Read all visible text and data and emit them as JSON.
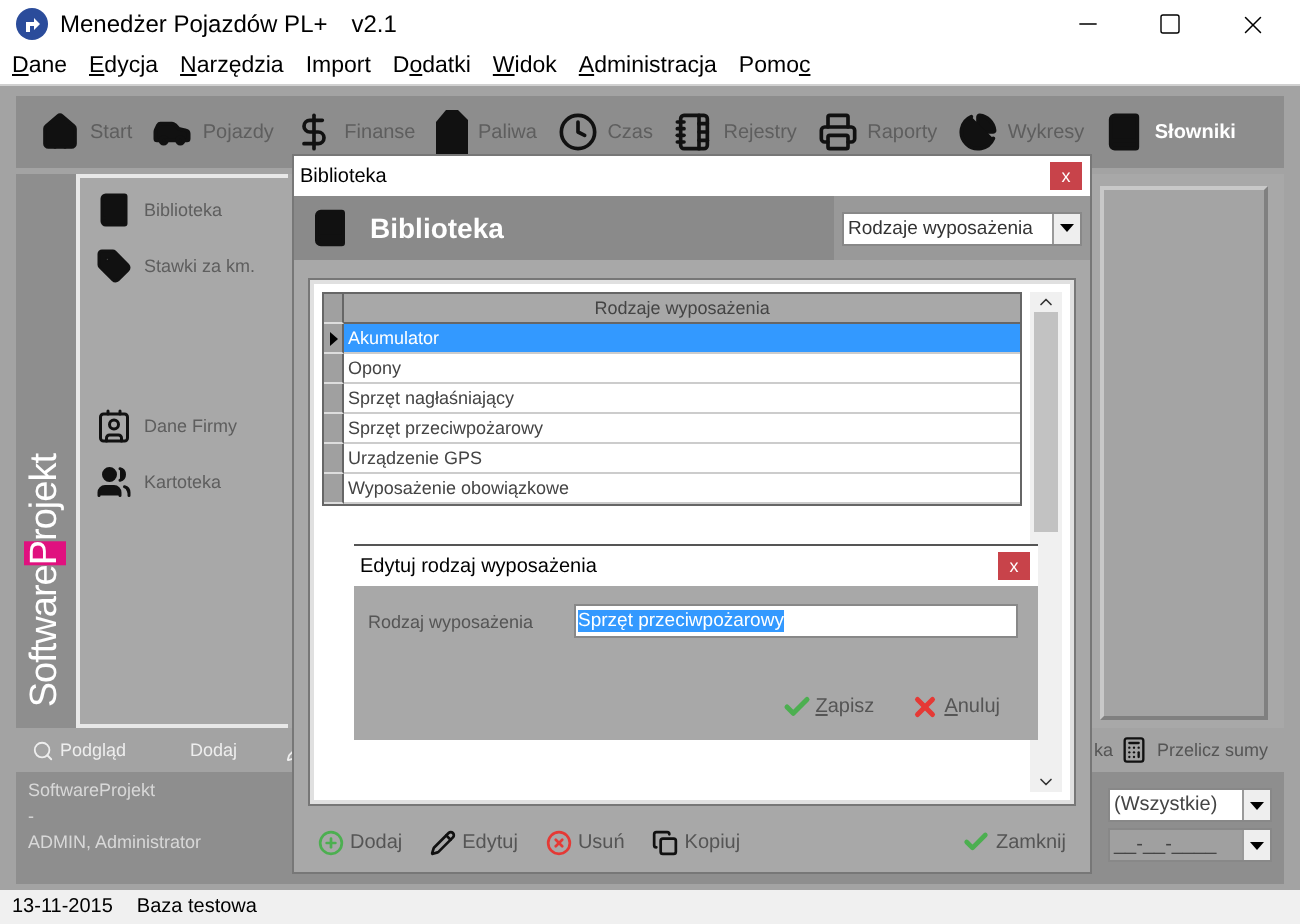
{
  "window": {
    "title": "Menedżer Pojazdów PL+",
    "version": "v2.1"
  },
  "menu": [
    {
      "key": "D",
      "after": "ane"
    },
    {
      "key": "E",
      "after": "dycja"
    },
    {
      "key": "N",
      "after": "arzędzia"
    },
    {
      "before": "Import"
    },
    {
      "before": "D",
      "key": "o",
      "after": "datki"
    },
    {
      "key": "W",
      "after": "idok"
    },
    {
      "key": "A",
      "after": "dministracja"
    },
    {
      "before": "Pomo",
      "key": "c"
    }
  ],
  "toolbar": [
    {
      "label": "Start",
      "selected": false
    },
    {
      "label": "Pojazdy",
      "selected": false
    },
    {
      "label": "Finanse",
      "selected": false
    },
    {
      "label": "Paliwa",
      "selected": false
    },
    {
      "label": "Czas",
      "selected": false
    },
    {
      "label": "Rejestry",
      "selected": false
    },
    {
      "label": "Raporty",
      "selected": false
    },
    {
      "label": "Wykresy",
      "selected": false
    },
    {
      "label": "Słowniki",
      "selected": true
    }
  ],
  "brand": {
    "before": "Software",
    "highlight": "P",
    "after": "rojekt"
  },
  "sidebar": {
    "groups": [
      [
        {
          "label": "Biblioteka"
        },
        {
          "label": "Stawki za km."
        }
      ],
      [
        {
          "label": "Dane Firmy"
        },
        {
          "label": "Kartoteka"
        }
      ]
    ]
  },
  "actions": {
    "left": [
      "Podgląd",
      "Dodaj"
    ],
    "right_cut": "ka",
    "right": "Przelicz sumy"
  },
  "info": [
    "SoftwareProjekt",
    "-",
    "ADMIN, Administrator"
  ],
  "filters": [
    {
      "value": "(Wszystkie)",
      "disabled": false
    },
    {
      "value": "__-__-____",
      "disabled": true
    }
  ],
  "status_bar": [
    "13-11-2015",
    "Baza testowa"
  ],
  "dialog": {
    "title": "Biblioteka",
    "header": "Biblioteka",
    "dropdown": "Rodzaje wyposażenia",
    "grid": {
      "column": "Rodzaje wyposażenia",
      "rows": [
        {
          "label": "Akumulator",
          "selected": true
        },
        {
          "label": "Opony",
          "selected": false
        },
        {
          "label": "Sprzęt nagłaśniający",
          "selected": false
        },
        {
          "label": "Sprzęt przeciwpożarowy",
          "selected": false
        },
        {
          "label": "Urządzenie GPS",
          "selected": false
        },
        {
          "label": "Wyposażenie obowiązkowe",
          "selected": false
        }
      ]
    },
    "edit": {
      "title": "Edytuj rodzaj wyposażenia",
      "close": "x",
      "field_label": "Rodzaj wyposażenia",
      "value": "Sprzęt przeciwpożarowy",
      "buttons": [
        {
          "key": "Z",
          "after": "apisz"
        },
        {
          "key": "A",
          "after": "nuluj"
        }
      ]
    },
    "close": "x",
    "buttons": [
      "Dodaj",
      "Edytuj",
      "Usuń",
      "Kopiuj"
    ],
    "close_button": "Zamknij"
  }
}
